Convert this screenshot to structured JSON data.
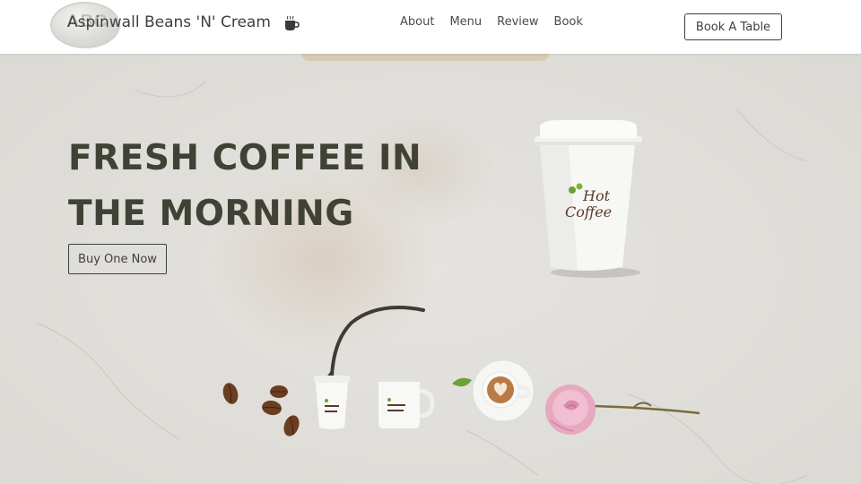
{
  "header": {
    "logo_text": "ABC",
    "brand_name": "Aspinwall Beans 'N' Cream",
    "nav": [
      "About",
      "Menu",
      "Review",
      "Book"
    ],
    "book_button": "Book A Table"
  },
  "hero": {
    "headline_line1": "FRESH COFFEE IN",
    "headline_line2": "THE MORNING",
    "cta_button": "Buy One Now",
    "cup_label_line1": "Hot",
    "cup_label_line2": "Coffee"
  },
  "icons": {
    "brand_icon": "coffee-cup-icon"
  },
  "colors": {
    "headline": "#404235",
    "background": "#e2e0dc",
    "accent_brown": "#5b3a26",
    "leaf_green": "#6aa236",
    "rose_pink": "#e6a9c0"
  }
}
